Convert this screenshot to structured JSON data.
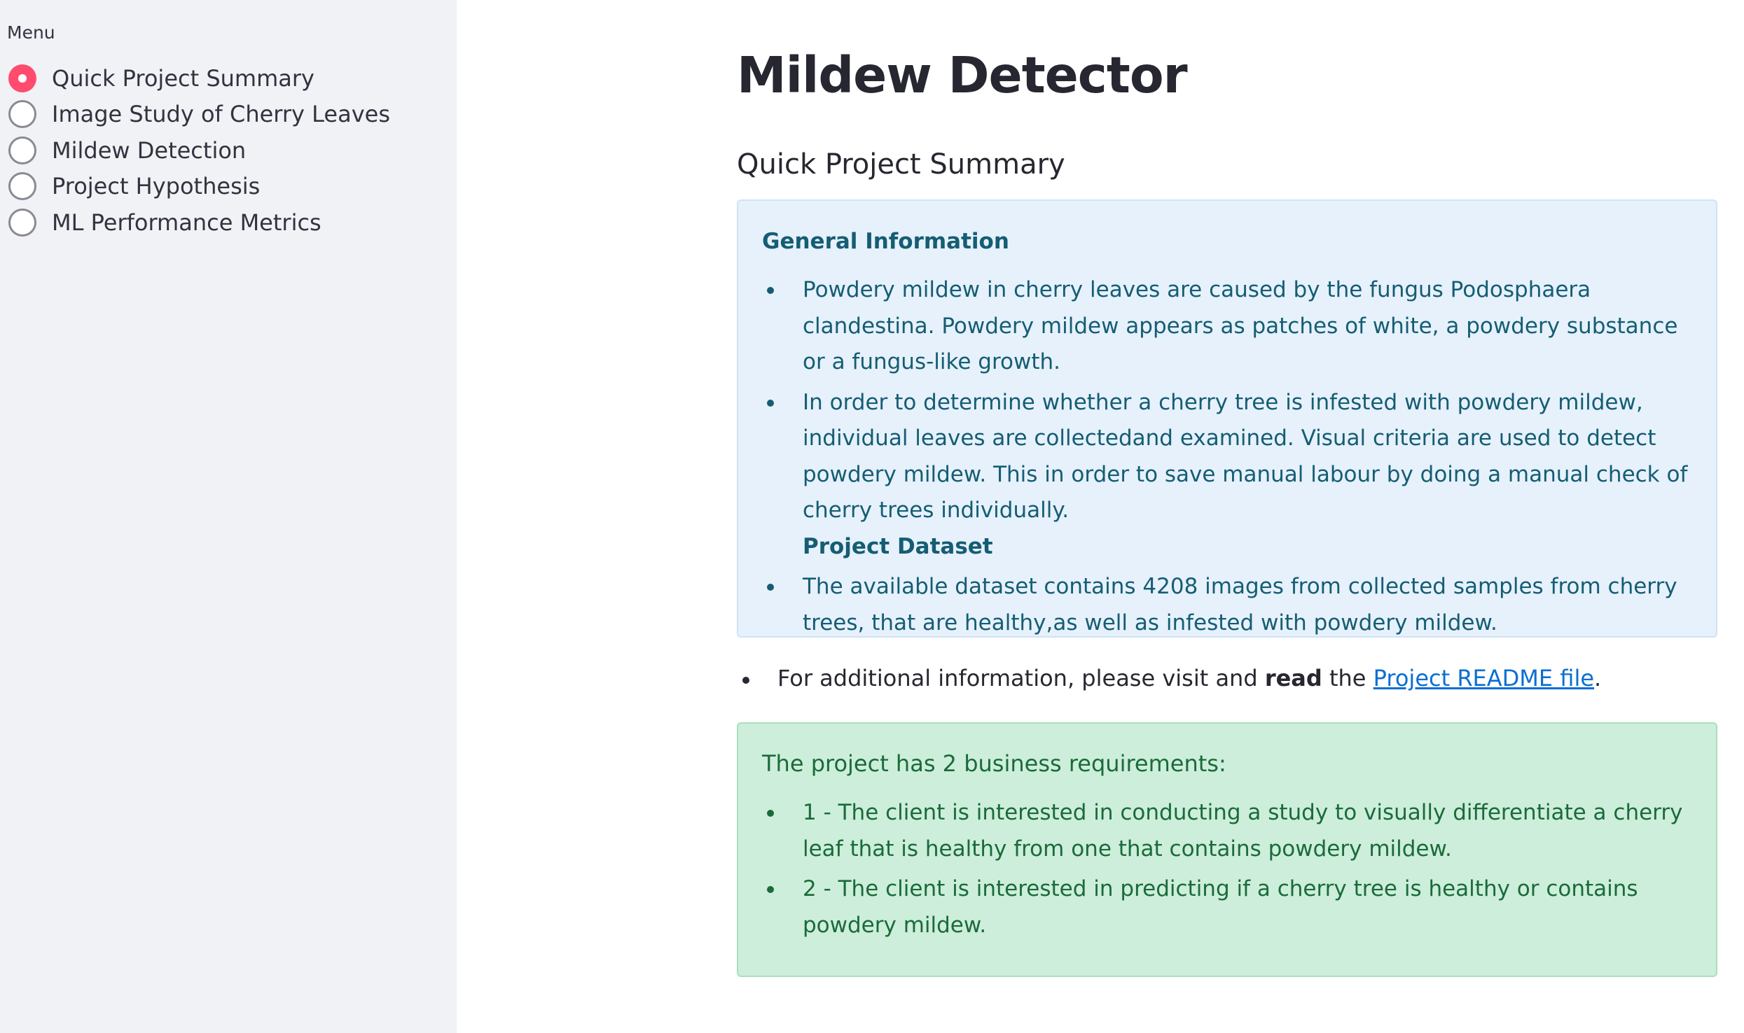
{
  "sidebar": {
    "menu_label": "Menu",
    "items": [
      {
        "label": "Quick Project Summary",
        "selected": true
      },
      {
        "label": "Image Study of Cherry Leaves",
        "selected": false
      },
      {
        "label": "Mildew Detection",
        "selected": false
      },
      {
        "label": "Project Hypothesis",
        "selected": false
      },
      {
        "label": "ML Performance Metrics",
        "selected": false
      }
    ]
  },
  "main": {
    "title": "Mildew Detector",
    "section_title": "Quick Project Summary",
    "info_box": {
      "heading": "General Information",
      "bullets": [
        "Powdery mildew in cherry leaves are caused by the fungus Podosphaera clandestina. Powdery mildew appears as patches of white, a powdery substance or a fungus-like growth.",
        "In order to determine whether a cherry tree is infested with powdery mildew, individual leaves are collectedand examined. Visual criteria are used to detect powdery mildew. This in order to save manual labour by doing a manual check of cherry trees individually."
      ],
      "subheading": "Project Dataset",
      "dataset_bullet": "The available dataset contains 4208 images from collected samples from cherry trees, that are healthy,as well as infested with powdery mildew."
    },
    "additional_info": {
      "prefix": "For additional information, please visit and ",
      "bold": "read",
      "middle": " the ",
      "link_text": "Project README file",
      "suffix": "."
    },
    "requirements_box": {
      "intro": "The project has 2 business requirements:",
      "bullets": [
        "1 - The client is interested in conducting a study to visually differentiate a cherry leaf that is healthy from one that contains powdery mildew.",
        "2 - The client is interested in predicting if a cherry tree is healthy or contains powdery mildew."
      ]
    }
  },
  "colors": {
    "radio_accent": "#ff4b6e",
    "info_bg": "#e6f1fb",
    "info_text": "#155d73",
    "success_bg": "#cdeedb",
    "success_text": "#1a6b3a",
    "link": "#0b6fd1"
  }
}
